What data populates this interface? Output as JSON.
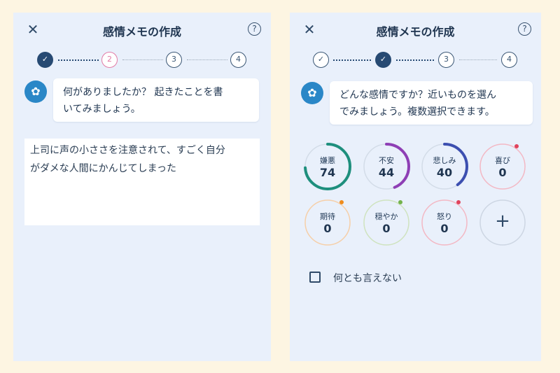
{
  "left": {
    "title": "感情メモの作成",
    "close": "✕",
    "help": "?",
    "steps": [
      "✓",
      "2",
      "3",
      "4"
    ],
    "prompt_line1": "何がありましたか？ 起きたことを書",
    "prompt_line2": "いてみましょう。",
    "entry_line1": "上司に声の小ささを注意されて、すごく自分",
    "entry_line2": "がダメな人間にかんじてしまった"
  },
  "right": {
    "title": "感情メモの作成",
    "close": "✕",
    "help": "?",
    "steps": [
      "✓",
      "✓",
      "3",
      "4"
    ],
    "prompt_line1": "どんな感情ですか？近いものを選ん",
    "prompt_line2": "でみましょう。複数選択できます。",
    "emotions": [
      {
        "label": "嫌悪",
        "value": "74",
        "level": 0.74,
        "color": "#1e8f7d"
      },
      {
        "label": "不安",
        "value": "44",
        "level": 0.44,
        "color": "#8e3fb5"
      },
      {
        "label": "悲しみ",
        "value": "40",
        "level": 0.4,
        "color": "#3c4fb0"
      },
      {
        "label": "喜び",
        "value": "0",
        "level": 0,
        "color": "#f3b8c4",
        "dot": "#e0435c"
      },
      {
        "label": "期待",
        "value": "0",
        "level": 0,
        "color": "#f6cfa8",
        "dot": "#ef8c1c"
      },
      {
        "label": "穏やか",
        "value": "0",
        "level": 0,
        "color": "#cfe3bf",
        "dot": "#74b34c"
      },
      {
        "label": "怒り",
        "value": "0",
        "level": 0,
        "color": "#f3b8c4",
        "dot": "#e0435c"
      }
    ],
    "add_label": "+",
    "none_label": "何とも言えない"
  }
}
